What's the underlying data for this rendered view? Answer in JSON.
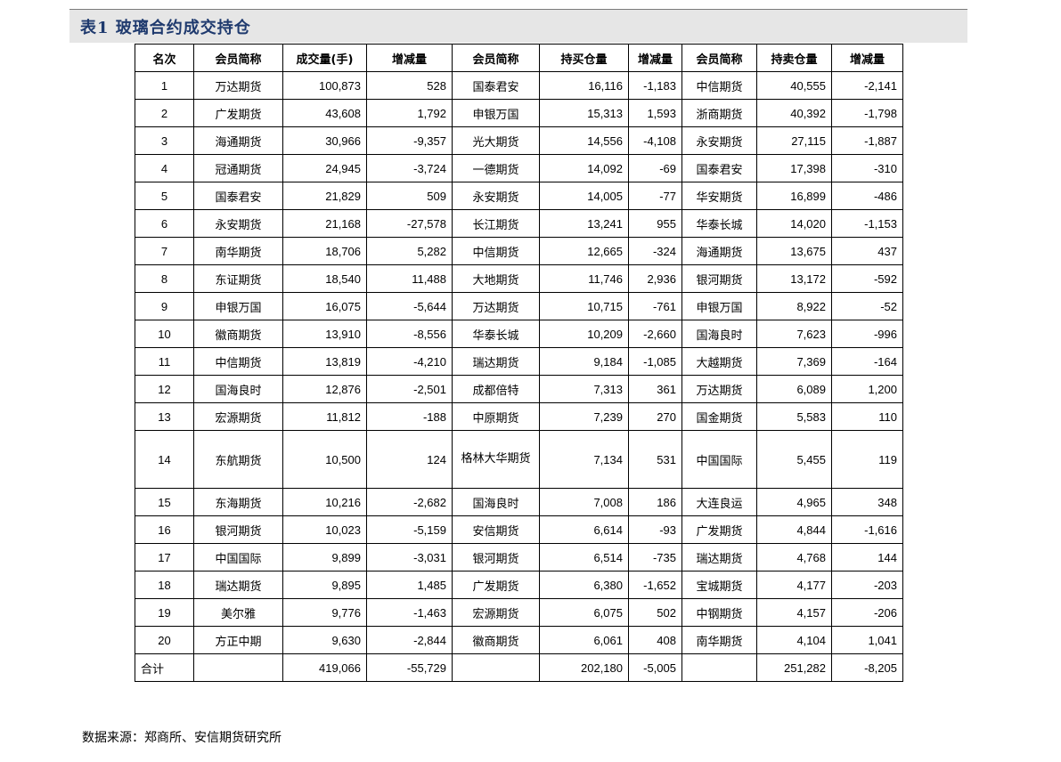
{
  "title": "表1 玻璃合约成交持仓",
  "headers": [
    "名次",
    "会员简称",
    "成交量(手)",
    "增减量",
    "会员简称",
    "持买仓量",
    "增减量",
    "会员简称",
    "持卖仓量",
    "增减量"
  ],
  "rows": [
    [
      "1",
      "万达期货",
      "100,873",
      "528",
      "国泰君安",
      "16,116",
      "-1,183",
      "中信期货",
      "40,555",
      "-2,141"
    ],
    [
      "2",
      "广发期货",
      "43,608",
      "1,792",
      "申银万国",
      "15,313",
      "1,593",
      "浙商期货",
      "40,392",
      "-1,798"
    ],
    [
      "3",
      "海通期货",
      "30,966",
      "-9,357",
      "光大期货",
      "14,556",
      "-4,108",
      "永安期货",
      "27,115",
      "-1,887"
    ],
    [
      "4",
      "冠通期货",
      "24,945",
      "-3,724",
      "一德期货",
      "14,092",
      "-69",
      "国泰君安",
      "17,398",
      "-310"
    ],
    [
      "5",
      "国泰君安",
      "21,829",
      "509",
      "永安期货",
      "14,005",
      "-77",
      "华安期货",
      "16,899",
      "-486"
    ],
    [
      "6",
      "永安期货",
      "21,168",
      "-27,578",
      "长江期货",
      "13,241",
      "955",
      "华泰长城",
      "14,020",
      "-1,153"
    ],
    [
      "7",
      "南华期货",
      "18,706",
      "5,282",
      "中信期货",
      "12,665",
      "-324",
      "海通期货",
      "13,675",
      "437"
    ],
    [
      "8",
      "东证期货",
      "18,540",
      "11,488",
      "大地期货",
      "11,746",
      "2,936",
      "银河期货",
      "13,172",
      "-592"
    ],
    [
      "9",
      "申银万国",
      "16,075",
      "-5,644",
      "万达期货",
      "10,715",
      "-761",
      "申银万国",
      "8,922",
      "-52"
    ],
    [
      "10",
      "徽商期货",
      "13,910",
      "-8,556",
      "华泰长城",
      "10,209",
      "-2,660",
      "国海良时",
      "7,623",
      "-996"
    ],
    [
      "11",
      "中信期货",
      "13,819",
      "-4,210",
      "瑞达期货",
      "9,184",
      "-1,085",
      "大越期货",
      "7,369",
      "-164"
    ],
    [
      "12",
      "国海良时",
      "12,876",
      "-2,501",
      "成都倍特",
      "7,313",
      "361",
      "万达期货",
      "6,089",
      "1,200"
    ],
    [
      "13",
      "宏源期货",
      "11,812",
      "-188",
      "中原期货",
      "7,239",
      "270",
      "国金期货",
      "5,583",
      "110"
    ],
    [
      "14",
      "东航期货",
      "10,500",
      "124",
      "格林大华期货",
      "7,134",
      "531",
      "中国国际",
      "5,455",
      "119"
    ],
    [
      "15",
      "东海期货",
      "10,216",
      "-2,682",
      "国海良时",
      "7,008",
      "186",
      "大连良运",
      "4,965",
      "348"
    ],
    [
      "16",
      "银河期货",
      "10,023",
      "-5,159",
      "安信期货",
      "6,614",
      "-93",
      "广发期货",
      "4,844",
      "-1,616"
    ],
    [
      "17",
      "中国国际",
      "9,899",
      "-3,031",
      "银河期货",
      "6,514",
      "-735",
      "瑞达期货",
      "4,768",
      "144"
    ],
    [
      "18",
      "瑞达期货",
      "9,895",
      "1,485",
      "广发期货",
      "6,380",
      "-1,652",
      "宝城期货",
      "4,177",
      "-203"
    ],
    [
      "19",
      "美尔雅",
      "9,776",
      "-1,463",
      "宏源期货",
      "6,075",
      "502",
      "中钢期货",
      "4,157",
      "-206"
    ],
    [
      "20",
      "方正中期",
      "9,630",
      "-2,844",
      "徽商期货",
      "6,061",
      "408",
      "南华期货",
      "4,104",
      "1,041"
    ]
  ],
  "total": [
    "合计",
    "",
    "419,066",
    "-55,729",
    "",
    "202,180",
    "-5,005",
    "",
    "251,282",
    "-8,205"
  ],
  "source": "数据来源：郑商所、安信期货研究所"
}
